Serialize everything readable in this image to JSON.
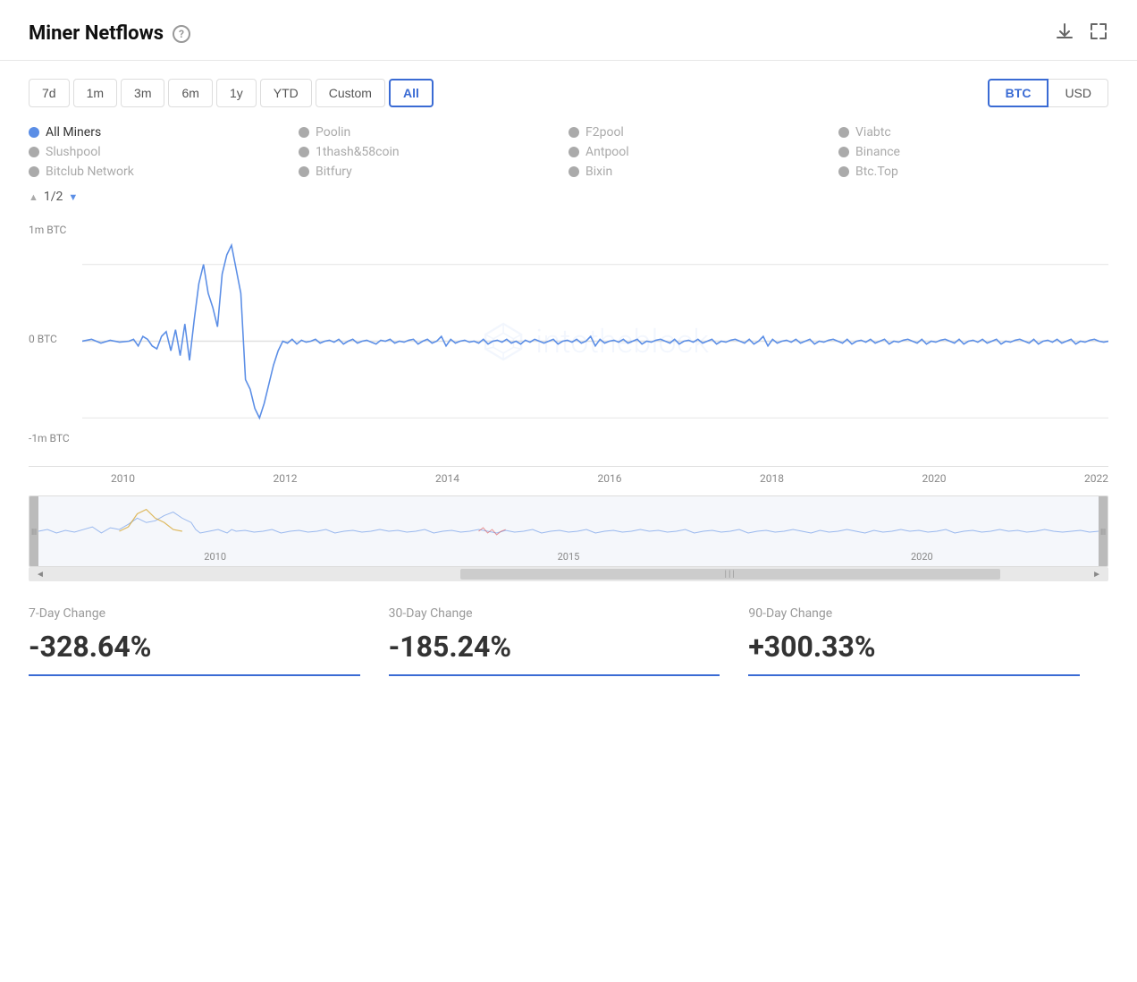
{
  "header": {
    "title": "Miner Netflows",
    "help_icon": "?",
    "download_icon": "⬇",
    "expand_icon": "⤢"
  },
  "toolbar": {
    "time_filters": [
      {
        "label": "7d",
        "active": false
      },
      {
        "label": "1m",
        "active": false
      },
      {
        "label": "3m",
        "active": false
      },
      {
        "label": "6m",
        "active": false
      },
      {
        "label": "1y",
        "active": false
      },
      {
        "label": "YTD",
        "active": false
      },
      {
        "label": "Custom",
        "active": false
      },
      {
        "label": "All",
        "active": true
      }
    ],
    "currency_filters": [
      {
        "label": "BTC",
        "active": true
      },
      {
        "label": "USD",
        "active": false
      }
    ]
  },
  "legend": {
    "items": [
      {
        "label": "All Miners",
        "active": true,
        "color": "blue"
      },
      {
        "label": "Poolin",
        "active": false,
        "color": "gray"
      },
      {
        "label": "F2pool",
        "active": false,
        "color": "gray"
      },
      {
        "label": "Viabtc",
        "active": false,
        "color": "gray"
      },
      {
        "label": "Slushpool",
        "active": false,
        "color": "gray"
      },
      {
        "label": "1thash&58coin",
        "active": false,
        "color": "gray"
      },
      {
        "label": "Antpool",
        "active": false,
        "color": "gray"
      },
      {
        "label": "Binance",
        "active": false,
        "color": "gray"
      },
      {
        "label": "Bitclub Network",
        "active": false,
        "color": "gray"
      },
      {
        "label": "Bitfury",
        "active": false,
        "color": "gray"
      },
      {
        "label": "Bixin",
        "active": false,
        "color": "gray"
      },
      {
        "label": "Btc.Top",
        "active": false,
        "color": "gray"
      }
    ],
    "pagination": "1/2"
  },
  "chart": {
    "y_top": "1m BTC",
    "y_mid": "0 BTC",
    "y_bottom": "-1m BTC",
    "x_labels": [
      "2010",
      "2012",
      "2014",
      "2016",
      "2018",
      "2020",
      "2022"
    ],
    "watermark": "intotheblock"
  },
  "navigator": {
    "x_labels": [
      "2010",
      "2015",
      "2020"
    ]
  },
  "stats": [
    {
      "label": "7-Day Change",
      "value": "-328.64%"
    },
    {
      "label": "30-Day Change",
      "value": "-185.24%"
    },
    {
      "label": "90-Day Change",
      "value": "+300.33%"
    }
  ]
}
